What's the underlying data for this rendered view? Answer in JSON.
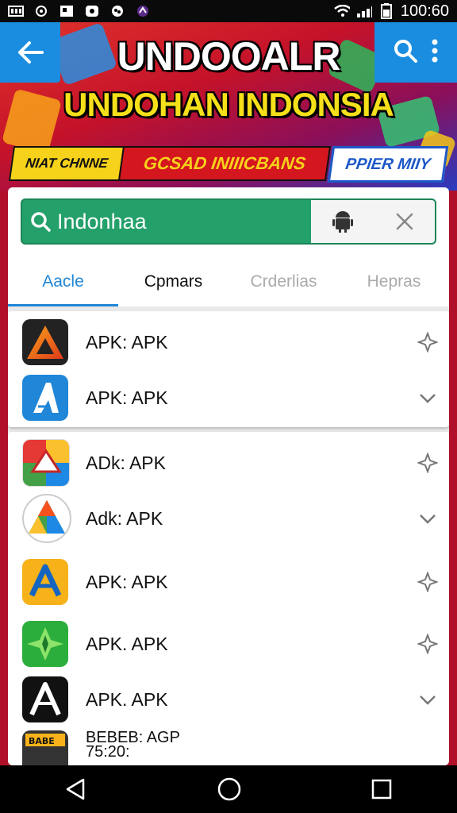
{
  "status_bar": {
    "time": "100:60",
    "left_icons": [
      "gallery-icon",
      "notification-icon",
      "news-icon",
      "chat-icon",
      "photo-icon",
      "app-icon"
    ],
    "right_icons": [
      "wifi-icon",
      "signal-icon",
      "battery-icon"
    ]
  },
  "banner": {
    "title_line1": "UNDOOALR",
    "title_line2": "UNDOHAN INDONSIA",
    "pills": [
      "NIAT CHNNE",
      "GCSAD INIIICBANS",
      "PPIER MIIY"
    ]
  },
  "toolbar": {
    "back_icon": "arrow-left-icon",
    "search_icon": "search-icon",
    "menu_icon": "more-vert-icon"
  },
  "search": {
    "value": "Indonhaa",
    "icons": [
      "search-icon",
      "android-icon",
      "close-icon"
    ]
  },
  "tabs": [
    {
      "label": "Aacle",
      "active": true
    },
    {
      "label": "Cpmars",
      "active": false
    },
    {
      "label": "Crderlias",
      "active": false
    },
    {
      "label": "Hepras",
      "active": false
    }
  ],
  "apps_group1": [
    {
      "label": "APK: APK",
      "icon": "triangle-app-icon",
      "action": "pin-icon"
    },
    {
      "label": "APK: APK",
      "icon": "a-logo-app-icon",
      "action": "chevron-down-icon"
    }
  ],
  "apps_group2": [
    {
      "label": "ADk: APK",
      "icon": "multicolor-app-icon",
      "action": "pin-icon"
    },
    {
      "label": "Adk: APK",
      "icon": "prism-app-icon",
      "action": "chevron-down-icon"
    },
    {
      "label": "APK: APK",
      "icon": "yellow-a-app-icon",
      "action": "pin-icon"
    },
    {
      "label": "APK. APK",
      "icon": "green-star-app-icon",
      "action": "pin-icon"
    },
    {
      "label": "APK. APK",
      "icon": "black-a-app-icon",
      "action": "chevron-down-icon"
    },
    {
      "label": "BEBEB: AGP",
      "sublabel": "75:20:",
      "icon": "game-app-icon",
      "action": ""
    }
  ],
  "colors": {
    "accent_blue": "#1f86d8",
    "search_green": "#24a06a",
    "banner_yellow": "#f5e01a"
  }
}
